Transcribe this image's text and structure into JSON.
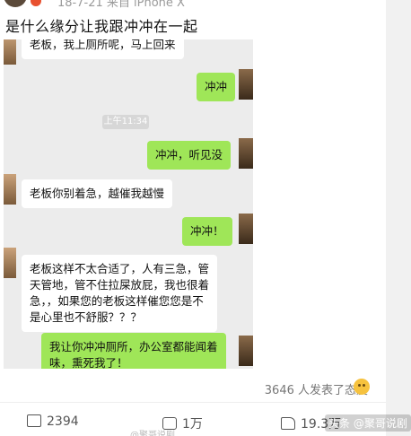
{
  "post": {
    "meta": "18-7-21 来自 iPhone X",
    "title": "是什么缘分让我跟冲冲在一起"
  },
  "chat": {
    "messages": [
      {
        "side": "in",
        "text": "老板，我上厕所呢，马上回来"
      },
      {
        "side": "out",
        "text": "冲冲"
      },
      {
        "side": "out",
        "text": "冲冲，听见没"
      },
      {
        "side": "in",
        "text": "老板你别着急，越催我越慢"
      },
      {
        "side": "out",
        "text": "冲冲！"
      },
      {
        "side": "in",
        "lines": [
          "老板这样不太合适了，人有三急，管",
          "天管地，管不住拉屎放屁，我也很着",
          "急，，如果您的老板这样催您您是不",
          "是心里也不舒服？？？"
        ]
      },
      {
        "side": "out",
        "lines": [
          "我让你冲冲厕所，办公室都能闻着",
          "味，熏死我了！"
        ]
      }
    ],
    "time_chip": "上午11:34"
  },
  "reactions": {
    "text": "3646 人发表了态度"
  },
  "actions": {
    "share": "2394",
    "comment": "1万",
    "like": "19.3万"
  },
  "watermark": "头条 @聚哥说剧",
  "watermark2": "@聚哥说剧"
}
